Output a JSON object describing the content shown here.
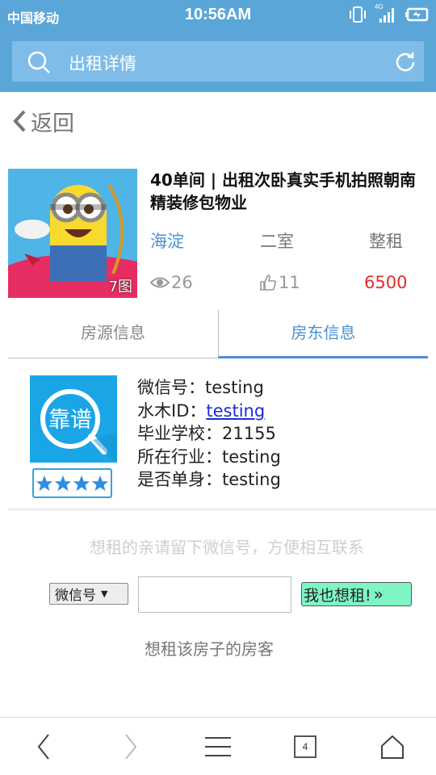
{
  "statusbar": {
    "carrier": "中国移动",
    "time": "10:56AM",
    "network": "4G"
  },
  "header": {
    "title": "出租详情"
  },
  "nav": {
    "back_label": "返回"
  },
  "listing": {
    "title": "40单间 | 出租次卧真实手机拍照朝南精装修包物业",
    "photo_count": "7图",
    "district": "海淀",
    "rooms": "二室",
    "rent_type": "整租",
    "views": "26",
    "likes": "11",
    "price": "6500"
  },
  "tabs": [
    {
      "label": "房源信息",
      "active": false
    },
    {
      "label": "房东信息",
      "active": true
    }
  ],
  "landlord": {
    "logo_text": "靠谱",
    "stars": 4,
    "rows": [
      {
        "label": "微信号：",
        "value": "testing"
      },
      {
        "label": "水木ID：",
        "value": "testing"
      },
      {
        "label": "毕业学校：",
        "value": "21155"
      },
      {
        "label": "所在行业：",
        "value": "testing"
      },
      {
        "label": "是否单身：",
        "value": "testing"
      }
    ]
  },
  "contact": {
    "hint": "想租的亲请留下微信号，方便相互联系",
    "select_value": "微信号",
    "input_value": "",
    "button_label": "我也想租!",
    "button_chevron": "»"
  },
  "tenants_title": "想租该房子的房客",
  "bottom_nav": {
    "tab_count": "4"
  },
  "colors": {
    "brand": "#5aa6d8",
    "accent": "#4a90d2",
    "price": "#e52b2b",
    "button": "#7ff5c5"
  }
}
